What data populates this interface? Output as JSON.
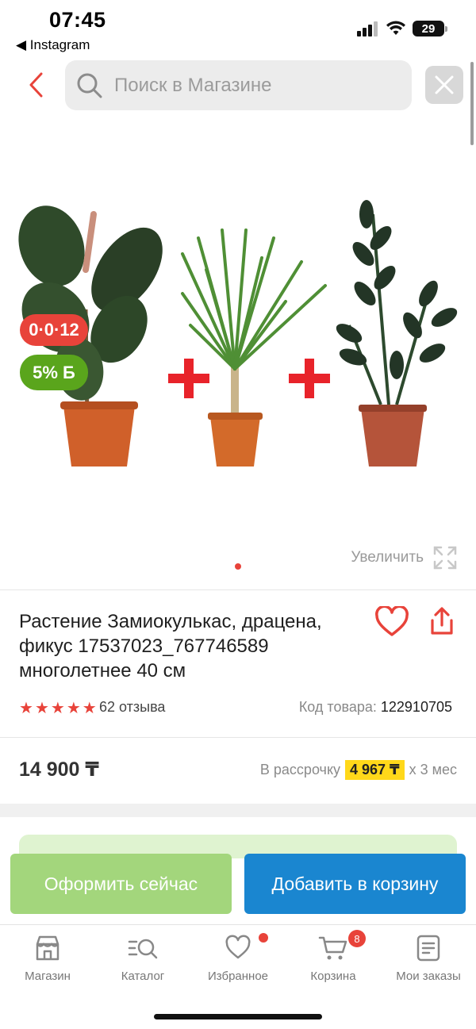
{
  "status_bar": {
    "time": "07:45",
    "back_app": "◀ Instagram",
    "battery": "29"
  },
  "header": {
    "search_placeholder": "Поиск в Магазине"
  },
  "badges": {
    "installment": "0·0·12",
    "bonus": "5% Б"
  },
  "gallery": {
    "zoom_label": "Увеличить",
    "image_count": 1,
    "active_index": 0
  },
  "product": {
    "title": "Растение Замиокулькас, драцена, фикус 17537023_767746589 многолетнее 40 см",
    "rating": 5,
    "reviews": "62 отзыва",
    "sku_label": "Код товара:",
    "sku_value": "122910705"
  },
  "pricing": {
    "price": "14 900 ₸",
    "installment_label": "В рассрочку",
    "installment_amount": "4 967 ₸",
    "installment_term": "х 3 мес"
  },
  "actions": {
    "order_now": "Оформить сейчас",
    "add_to_cart": "Добавить в корзину"
  },
  "tabbar": {
    "items": [
      {
        "label": "Магазин",
        "icon": "store-icon"
      },
      {
        "label": "Каталог",
        "icon": "catalog-search-icon"
      },
      {
        "label": "Избранное",
        "icon": "heart-icon",
        "dot": true
      },
      {
        "label": "Корзина",
        "icon": "cart-icon",
        "badge": "8"
      },
      {
        "label": "Мои заказы",
        "icon": "orders-icon"
      }
    ]
  },
  "colors": {
    "accent_red": "#e8433a",
    "primary_blue": "#1a86d0",
    "order_green": "#a3d67c",
    "bonus_green": "#5aa51c",
    "installment_yellow": "#ffd81a"
  }
}
